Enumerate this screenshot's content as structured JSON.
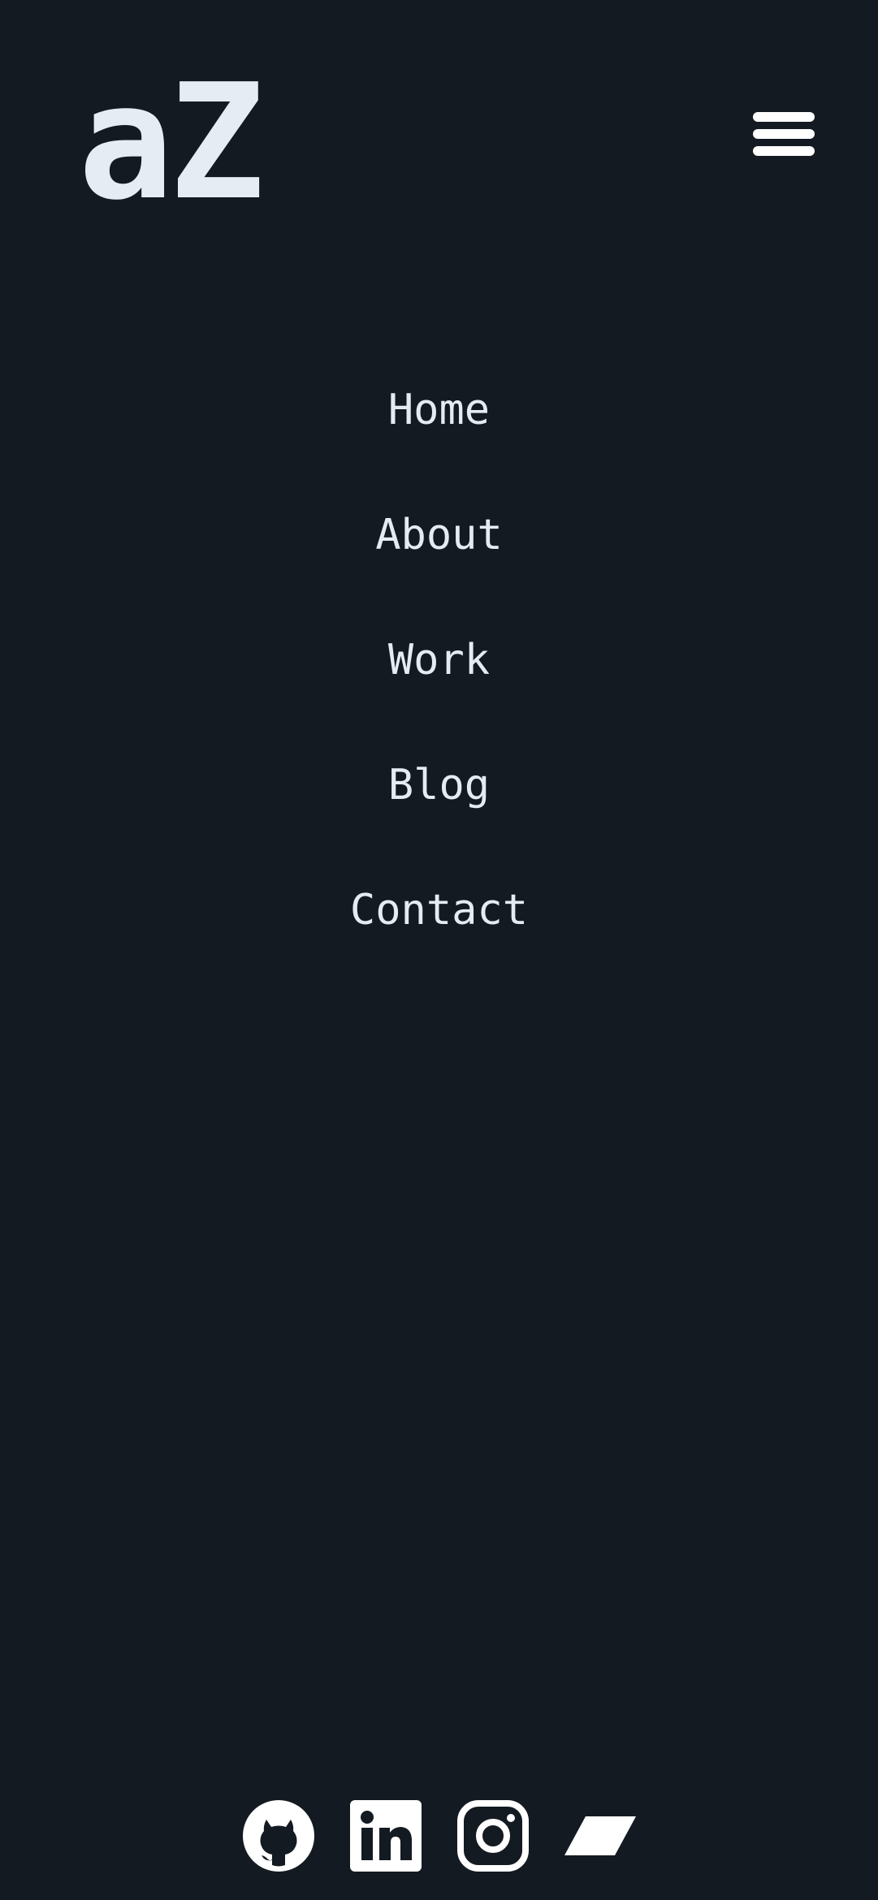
{
  "header": {
    "logo_text": "aZ",
    "menu_icon": "hamburger-menu-icon"
  },
  "nav": {
    "items": [
      {
        "label": "Home"
      },
      {
        "label": "About"
      },
      {
        "label": "Work"
      },
      {
        "label": "Blog"
      },
      {
        "label": "Contact"
      }
    ]
  },
  "social": {
    "icons": [
      "github-icon",
      "linkedin-icon",
      "instagram-icon",
      "parallelogram-icon"
    ]
  },
  "colors": {
    "background": "#141a21",
    "text": "#e5ebf3",
    "icon": "#ffffff"
  }
}
